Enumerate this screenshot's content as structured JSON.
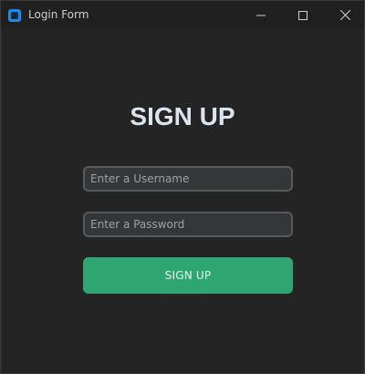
{
  "window": {
    "title": "Login Form",
    "app_icon": "app-icon",
    "controls": [
      "minimize-icon",
      "maximize-icon",
      "close-icon"
    ]
  },
  "form": {
    "heading": "SIGN UP",
    "username_placeholder": "Enter a Username",
    "username_value": "",
    "password_placeholder": "Enter a Password",
    "password_value": "",
    "submit_label": "SIGN UP"
  },
  "colors": {
    "accent": "#2fa572",
    "background": "#242424",
    "field_bg": "#343638",
    "field_border": "#565b5e",
    "app_icon": "#1e88e5"
  }
}
